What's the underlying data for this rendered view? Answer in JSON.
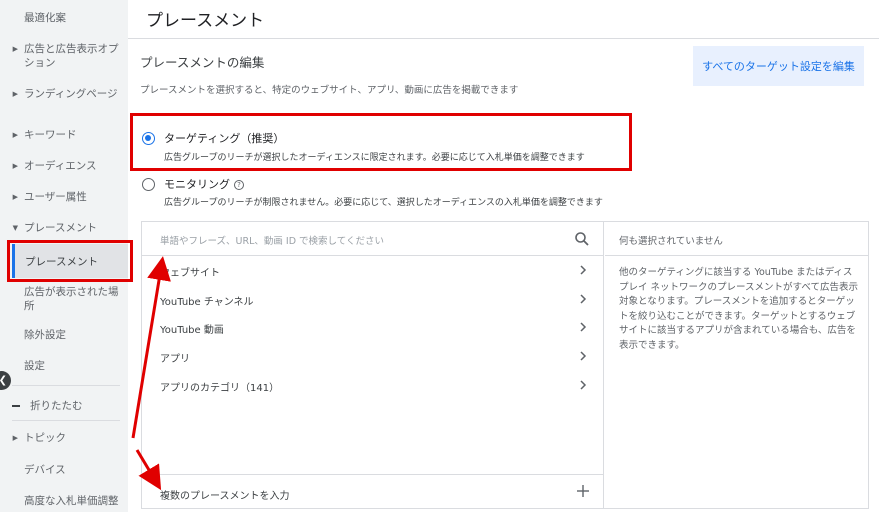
{
  "sidebar": {
    "items": [
      {
        "label": "最適化案",
        "has_arrow": false
      },
      {
        "label": "広告と広告表示オプション",
        "has_arrow": true
      },
      {
        "label": "ランディングページ",
        "has_arrow": true
      },
      {
        "label": "キーワード",
        "has_arrow": true
      },
      {
        "label": "オーディエンス",
        "has_arrow": true
      },
      {
        "label": "ユーザー属性",
        "has_arrow": true
      },
      {
        "label": "プレースメント",
        "has_arrow": true,
        "expanded": true
      }
    ],
    "children": [
      {
        "label": "プレースメント",
        "selected": true
      },
      {
        "label": "広告が表示された場所"
      },
      {
        "label": "除外設定"
      }
    ],
    "settings_label": "設定",
    "collapse_label": "折りたたむ",
    "lower_items": [
      {
        "label": "トピック",
        "has_arrow": true
      },
      {
        "label": "デバイス",
        "has_arrow": false
      },
      {
        "label": "高度な入札単価調整",
        "has_arrow": false
      }
    ]
  },
  "main": {
    "page_title": "プレースメント",
    "section_title": "プレースメントの編集",
    "section_desc": "プレースメントを選択すると、特定のウェブサイト、アプリ、動画に広告を掲載できます",
    "edit_all_button": "すべてのターゲット設定を編集",
    "options": [
      {
        "label": "ターゲティング（推奨）",
        "desc": "広告グループのリーチが選択したオーディエンスに限定されます。必要に応じて入札単価を調整できます",
        "checked": true
      },
      {
        "label": "モニタリング",
        "desc": "広告グループのリーチが制限されません。必要に応じて、選択したオーディエンスの入札単価を調整できます",
        "checked": false
      }
    ],
    "search_placeholder": "単語やフレーズ、URL、動画 ID で検索してください",
    "list": [
      "ウェブサイト",
      "YouTube チャンネル",
      "YouTube 動画",
      "アプリ",
      "アプリのカテゴリ（141）"
    ],
    "bulk_add": "複数のプレースメントを入力",
    "right_header": "何も選択されていません",
    "right_body": "他のターゲティングに該当する YouTube またはディスプレイ ネットワークのプレースメントがすべて広告表示対象となります。プレースメントを追加するとターゲットを絞り込むことができます。ターゲットとするウェブサイトに該当するアプリが含まれている場合も、広告を表示できます。"
  },
  "colors": {
    "accent": "#1a73e8",
    "annotation_red": "#e00000",
    "sidebar_bg": "#f1f3f4"
  },
  "icons": [
    "search-icon",
    "chevron-right-icon",
    "plus-icon",
    "help-icon",
    "chevron-left-icon",
    "triangle-right-icon"
  ]
}
